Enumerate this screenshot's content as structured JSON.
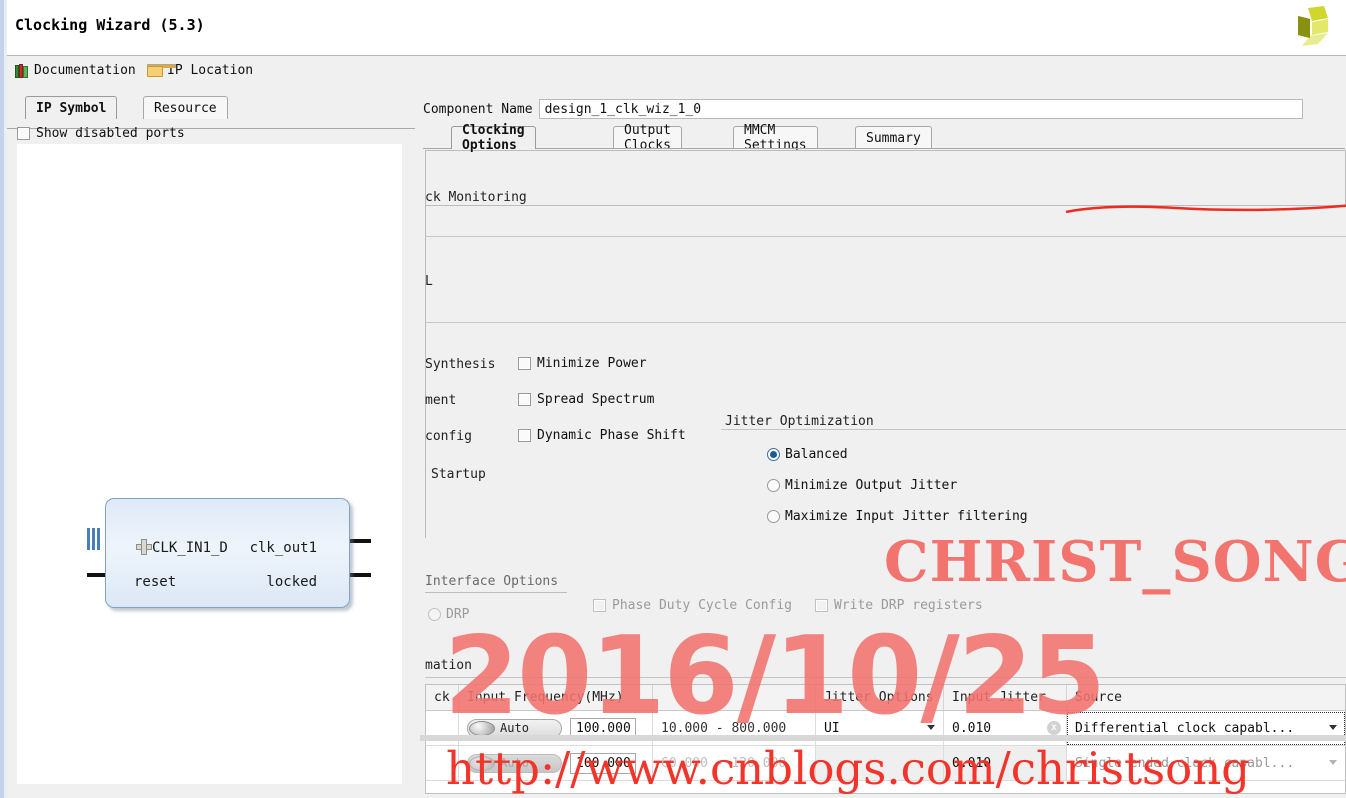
{
  "window": {
    "title": "Clocking Wizard (5.3)",
    "logo": "xilinx-logo"
  },
  "toolbar": {
    "documentation": "Documentation",
    "ip_location": "IP Location"
  },
  "left_panel": {
    "tabs": [
      {
        "label": "IP Symbol",
        "active": true
      },
      {
        "label": "Resource",
        "active": false
      }
    ],
    "show_disabled_ports": "Show disabled ports",
    "symbol": {
      "inputs": [
        "CLK_IN1_D",
        "reset"
      ],
      "outputs": [
        "clk_out1",
        "locked"
      ]
    }
  },
  "right_panel": {
    "component_name_label": "Component Name",
    "component_name_value": "design_1_clk_wiz_1_0",
    "tabs": [
      {
        "label": "Clocking Options",
        "active": true
      },
      {
        "label": "Output Clocks",
        "active": false
      },
      {
        "label": "MMCM Settings",
        "active": false
      },
      {
        "label": "Summary",
        "active": false
      }
    ],
    "clipped_labels": {
      "clock_monitoring": "ck Monitoring",
      "pll": "L",
      "synthesis": "Synthesis",
      "ment": "ment",
      "config": "config",
      "startup": "Startup",
      "information": "mation"
    },
    "checkboxes": [
      {
        "label": "Minimize Power",
        "checked": false
      },
      {
        "label": "Spread Spectrum",
        "checked": false
      },
      {
        "label": "Dynamic Phase Shift",
        "checked": false
      }
    ],
    "jitter_optimization": {
      "title": "Jitter Optimization",
      "options": [
        {
          "label": "Balanced",
          "selected": true
        },
        {
          "label": "Minimize Output Jitter",
          "selected": false
        },
        {
          "label": "Maximize Input Jitter filtering",
          "selected": false
        }
      ]
    },
    "interface_options": {
      "title": "Interface Options",
      "drp": "DRP",
      "phase_duty": "Phase Duty Cycle Config",
      "write_drp": "Write DRP registers"
    },
    "table": {
      "headers": [
        "ck",
        "Input Frequency(MHz)",
        "",
        "Jitter Options",
        "Input Jitter",
        "Source"
      ],
      "rows": [
        {
          "auto": "Auto",
          "frequency": "100.000",
          "range": "10.000 - 800.000",
          "jitter_option": "UI",
          "input_jitter": "0.010",
          "source": "Differential clock capabl...",
          "enabled": true
        },
        {
          "auto": "Auto",
          "frequency": "100.000",
          "range": "60.000 - 120.000",
          "jitter_option": "",
          "input_jitter": "0.010",
          "source": "Single ended clock capabl...",
          "enabled": false
        }
      ],
      "clear_icon": "x"
    }
  },
  "watermarks": {
    "name": "CHRIST_SONG",
    "date": "2016/10/25",
    "url": "http://www.cnblogs.com/christsong",
    "color": "#f3736f"
  }
}
